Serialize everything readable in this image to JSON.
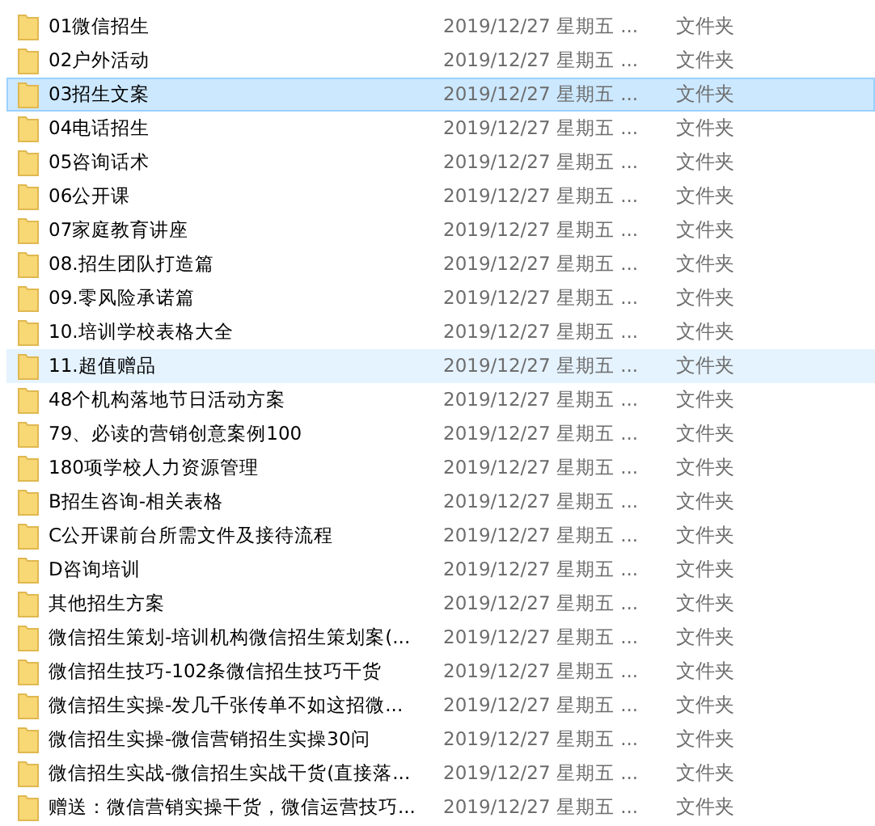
{
  "rows": [
    {
      "name": "01微信招生",
      "date": "2019/12/27 星期五 ...",
      "type": "文件夹",
      "selected": false,
      "hovered": false
    },
    {
      "name": "02户外活动",
      "date": "2019/12/27 星期五 ...",
      "type": "文件夹",
      "selected": false,
      "hovered": false
    },
    {
      "name": "03招生文案",
      "date": "2019/12/27 星期五 ...",
      "type": "文件夹",
      "selected": true,
      "hovered": false
    },
    {
      "name": "04电话招生",
      "date": "2019/12/27 星期五 ...",
      "type": "文件夹",
      "selected": false,
      "hovered": false
    },
    {
      "name": "05咨询话术",
      "date": "2019/12/27 星期五 ...",
      "type": "文件夹",
      "selected": false,
      "hovered": false
    },
    {
      "name": "06公开课",
      "date": "2019/12/27 星期五 ...",
      "type": "文件夹",
      "selected": false,
      "hovered": false
    },
    {
      "name": "07家庭教育讲座",
      "date": "2019/12/27 星期五 ...",
      "type": "文件夹",
      "selected": false,
      "hovered": false
    },
    {
      "name": "08.招生团队打造篇",
      "date": "2019/12/27 星期五 ...",
      "type": "文件夹",
      "selected": false,
      "hovered": false
    },
    {
      "name": "09.零风险承诺篇",
      "date": "2019/12/27 星期五 ...",
      "type": "文件夹",
      "selected": false,
      "hovered": false
    },
    {
      "name": "10.培训学校表格大全",
      "date": "2019/12/27 星期五 ...",
      "type": "文件夹",
      "selected": false,
      "hovered": false
    },
    {
      "name": "11.超值赠品",
      "date": "2019/12/27 星期五 ...",
      "type": "文件夹",
      "selected": false,
      "hovered": true
    },
    {
      "name": "48个机构落地节日活动方案",
      "date": "2019/12/27 星期五 ...",
      "type": "文件夹",
      "selected": false,
      "hovered": false
    },
    {
      "name": "79、必读的营销创意案例100",
      "date": "2019/12/27 星期五 ...",
      "type": "文件夹",
      "selected": false,
      "hovered": false
    },
    {
      "name": "180项学校人力资源管理",
      "date": "2019/12/27 星期五 ...",
      "type": "文件夹",
      "selected": false,
      "hovered": false
    },
    {
      "name": "B招生咨询-相关表格",
      "date": "2019/12/27 星期五 ...",
      "type": "文件夹",
      "selected": false,
      "hovered": false
    },
    {
      "name": "C公开课前台所需文件及接待流程",
      "date": "2019/12/27 星期五 ...",
      "type": "文件夹",
      "selected": false,
      "hovered": false
    },
    {
      "name": "D咨询培训",
      "date": "2019/12/27 星期五 ...",
      "type": "文件夹",
      "selected": false,
      "hovered": false
    },
    {
      "name": "其他招生方案",
      "date": "2019/12/27 星期五 ...",
      "type": "文件夹",
      "selected": false,
      "hovered": false
    },
    {
      "name": "微信招生策划-培训机构微信招生策划案(...",
      "date": "2019/12/27 星期五 ...",
      "type": "文件夹",
      "selected": false,
      "hovered": false
    },
    {
      "name": "微信招生技巧-102条微信招生技巧干货",
      "date": "2019/12/27 星期五 ...",
      "type": "文件夹",
      "selected": false,
      "hovered": false
    },
    {
      "name": "微信招生实操-发几千张传单不如这招微...",
      "date": "2019/12/27 星期五 ...",
      "type": "文件夹",
      "selected": false,
      "hovered": false
    },
    {
      "name": "微信招生实操-微信营销招生实操30问",
      "date": "2019/12/27 星期五 ...",
      "type": "文件夹",
      "selected": false,
      "hovered": false
    },
    {
      "name": "微信招生实战-微信招生实战干货(直接落...",
      "date": "2019/12/27 星期五 ...",
      "type": "文件夹",
      "selected": false,
      "hovered": false
    },
    {
      "name": "赠送：微信营销实操干货，微信运营技巧...",
      "date": "2019/12/27 星期五 ...",
      "type": "文件夹",
      "selected": false,
      "hovered": false
    }
  ]
}
